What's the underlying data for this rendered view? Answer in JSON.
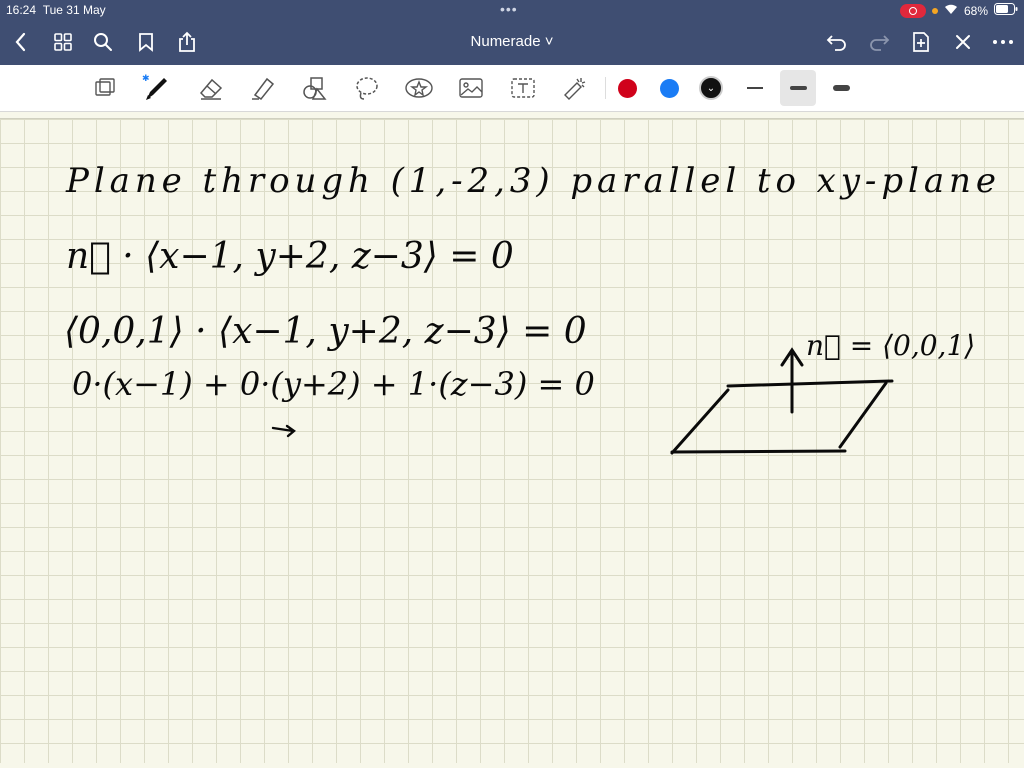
{
  "status": {
    "time": "16:24",
    "date": "Tue 31 May",
    "battery": "68%"
  },
  "nav": {
    "title": "Numerade ˅"
  },
  "colors": {
    "red": "#d0021b",
    "blue": "#1a7cf5",
    "black": "#111111"
  },
  "notes": {
    "line1": "Plane through (1,-2,3) parallel to xy-plane",
    "line2": "n⃗ · ⟨x−1, y+2, z−3⟩ = 0",
    "line3": "⟨0,0,1⟩ · ⟨x−1, y+2, z−3⟩ = 0",
    "line4": "0·(x−1) + 0·(y+2) + 1·(z−3) = 0",
    "normal_label": "n⃗ = ⟨0,0,1⟩"
  }
}
